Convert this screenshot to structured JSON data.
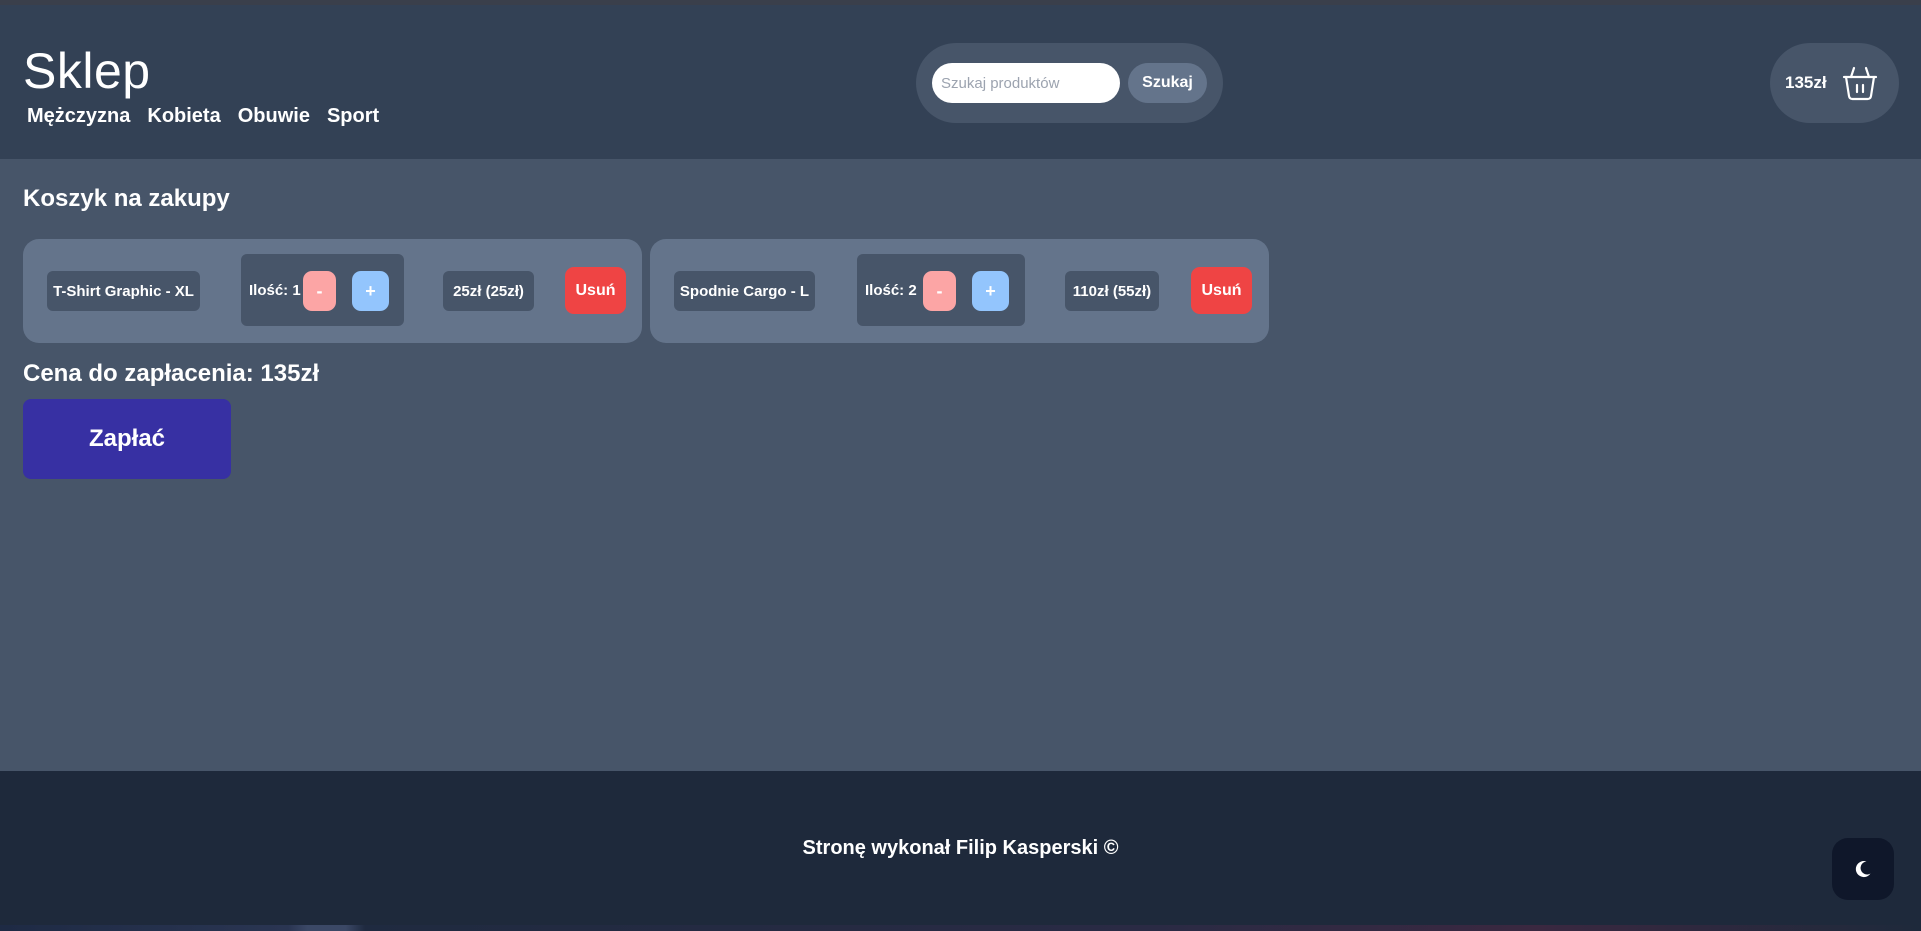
{
  "header": {
    "logo": "Sklep",
    "nav": [
      "Mężczyzna",
      "Kobieta",
      "Obuwie",
      "Sport"
    ],
    "search": {
      "placeholder": "Szukaj produktów",
      "value": "",
      "button": "Szukaj"
    },
    "cart_total": "135zł",
    "cart_icon": "basket-icon"
  },
  "main": {
    "title": "Koszyk na zakupy",
    "items": [
      {
        "name": "T-Shirt Graphic - XL",
        "qty_label": "Ilość: 1",
        "minus": "-",
        "plus": "+",
        "price": "25zł (25zł)",
        "remove": "Usuń"
      },
      {
        "name": "Spodnie Cargo - L",
        "qty_label": "Ilość: 2",
        "minus": "-",
        "plus": "+",
        "price": "110zł (55zł)",
        "remove": "Usuń"
      }
    ],
    "total_label": "Cena do zapłacenia: 135zł",
    "pay_button": "Zapłać"
  },
  "footer": {
    "text": "Stronę wykonał Filip Kasperski ©",
    "theme_icon": "moon-icon"
  },
  "colors": {
    "header_bg": "#334155",
    "main_bg": "#475569",
    "card_bg": "#64748b",
    "footer_bg": "#1e293b",
    "pay": "#3730a3",
    "remove": "#ef4444",
    "minus": "#fca5a5",
    "plus": "#93c5fd"
  }
}
